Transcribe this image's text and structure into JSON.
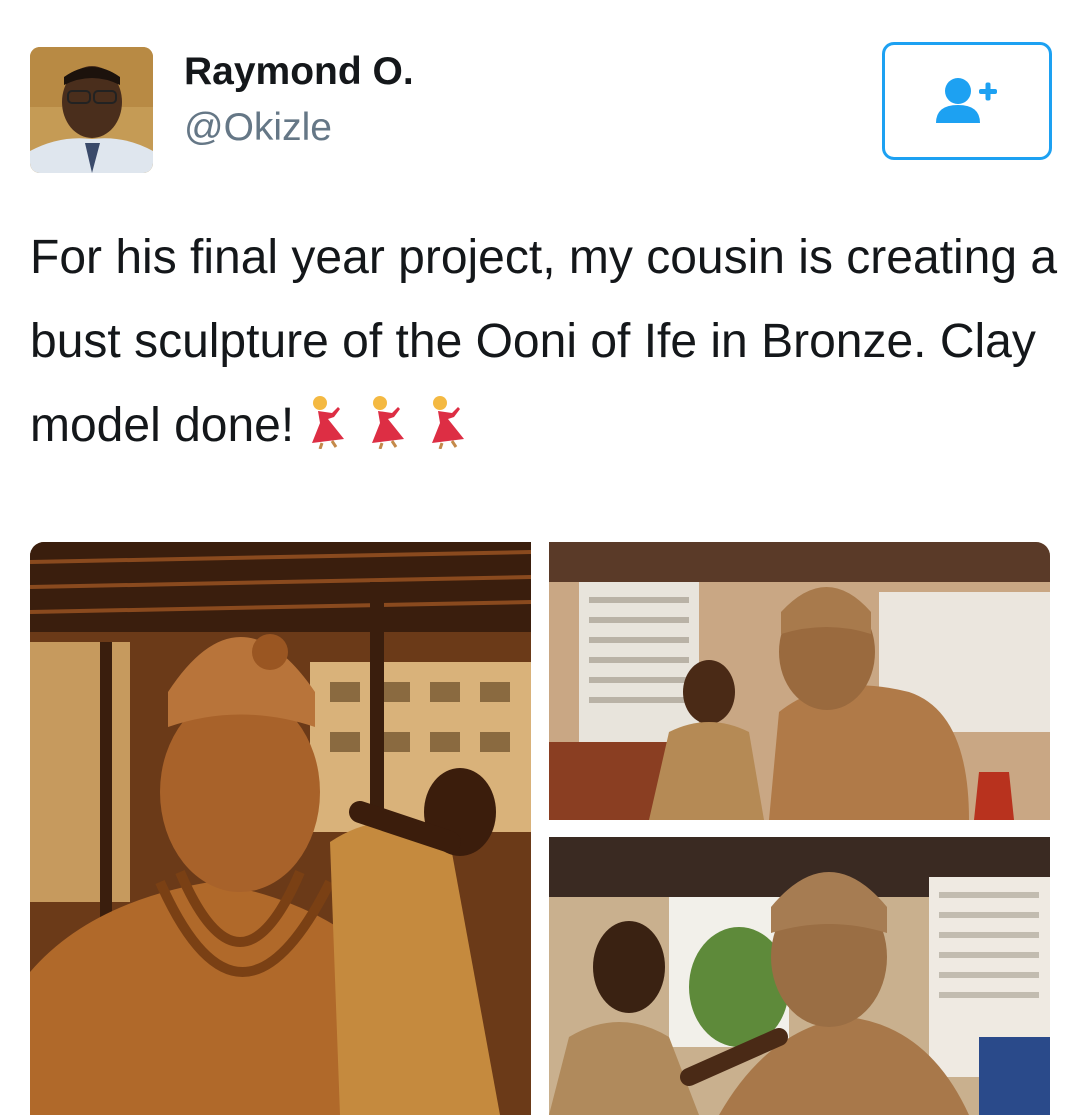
{
  "user": {
    "name": "Raymond O.",
    "handle": "@Okizle",
    "avatar_icon": "profile-photo"
  },
  "follow_button": {
    "icon": "add-user-icon",
    "color": "#1da1f2"
  },
  "tweet": {
    "text": "For his final year project, my cousin is creating a bust sculpture of the Ooni of Ife in Bronze. Clay model done!",
    "emojis": [
      "dancer-emoji",
      "dancer-emoji",
      "dancer-emoji"
    ]
  },
  "media": {
    "photo_count": 3,
    "photo_icons": [
      "clay-bust-photo",
      "clay-bust-photo",
      "clay-bust-photo"
    ]
  },
  "colors": {
    "text": "#14171a",
    "secondary": "#657786",
    "accent": "#1da1f2"
  }
}
